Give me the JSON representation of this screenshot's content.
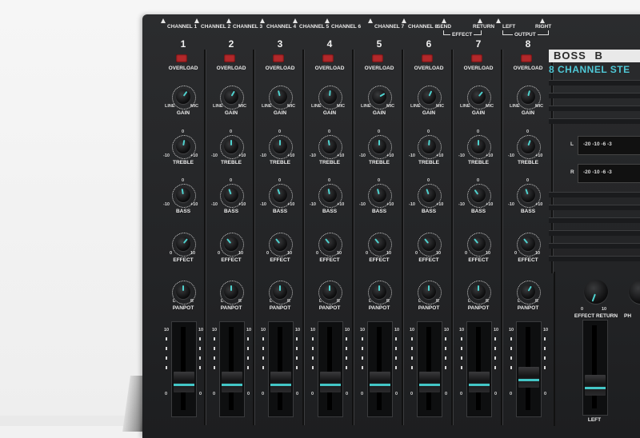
{
  "brand": {
    "logo_text": "BOSS",
    "logo_suffix": "B",
    "model_line": "8 CHANNEL STE"
  },
  "top_labels": {
    "channels": [
      "CHANNEL 1",
      "CHANNEL 2",
      "CHANNEL 3",
      "CHANNEL 4",
      "CHANNEL 5",
      "CHANNEL 6",
      "CHANNEL 7",
      "CHANNEL 8"
    ],
    "send": "SEND",
    "return": "RETURN",
    "effect": "EFFECT",
    "left": "LEFT",
    "right": "RIGHT",
    "output": "OUTPUT"
  },
  "channels": [
    {
      "number": "1",
      "overload": "OVERLOAD",
      "gain": "GAIN",
      "gain_line": "LINE",
      "gain_mic": "MIC",
      "treble": "TREBLE",
      "bass": "BASS",
      "effect": "EFFECT",
      "panpot": "PANPOT"
    },
    {
      "number": "2",
      "overload": "OVERLOAD",
      "gain": "GAIN",
      "gain_line": "LINE",
      "gain_mic": "MIC",
      "treble": "TREBLE",
      "bass": "BASS",
      "effect": "EFFECT",
      "panpot": "PANPOT"
    },
    {
      "number": "3",
      "overload": "OVERLOAD",
      "gain": "GAIN",
      "gain_line": "LINE",
      "gain_mic": "MIC",
      "treble": "TREBLE",
      "bass": "BASS",
      "effect": "EFFECT",
      "panpot": "PANPOT"
    },
    {
      "number": "4",
      "overload": "OVERLOAD",
      "gain": "GAIN",
      "gain_line": "LINE",
      "gain_mic": "MIC",
      "treble": "TREBLE",
      "bass": "BASS",
      "effect": "EFFECT",
      "panpot": "PANPOT"
    },
    {
      "number": "5",
      "overload": "OVERLOAD",
      "gain": "GAIN",
      "gain_line": "LINE",
      "gain_mic": "MIC",
      "treble": "TREBLE",
      "bass": "BASS",
      "effect": "EFFECT",
      "panpot": "PANPOT"
    },
    {
      "number": "6",
      "overload": "OVERLOAD",
      "gain": "GAIN",
      "gain_line": "LINE",
      "gain_mic": "MIC",
      "treble": "TREBLE",
      "bass": "BASS",
      "effect": "EFFECT",
      "panpot": "PANPOT"
    },
    {
      "number": "7",
      "overload": "OVERLOAD",
      "gain": "GAIN",
      "gain_line": "LINE",
      "gain_mic": "MIC",
      "treble": "TREBLE",
      "bass": "BASS",
      "effect": "EFFECT",
      "panpot": "PANPOT"
    },
    {
      "number": "8",
      "overload": "OVERLOAD",
      "gain": "GAIN",
      "gain_line": "LINE",
      "gain_mic": "MIC",
      "treble": "TREBLE",
      "bass": "BASS",
      "effect": "EFFECT",
      "panpot": "PANPOT"
    }
  ],
  "scale": {
    "minus10": "-10",
    "zero": "0",
    "plus10": "+10",
    "ten": "10",
    "left": "L",
    "right": "R"
  },
  "meters": {
    "left_label": "L",
    "right_label": "R",
    "scale": "-20 -10 -6 -3"
  },
  "master": {
    "effect_return": "EFFECT RETURN",
    "ph": "PH",
    "left": "LEFT",
    "zero": "0",
    "ten": "10"
  },
  "colors": {
    "panel": "#26272a",
    "accent": "#4fd2cf",
    "led": "#b4282a",
    "text": "#ececec"
  }
}
